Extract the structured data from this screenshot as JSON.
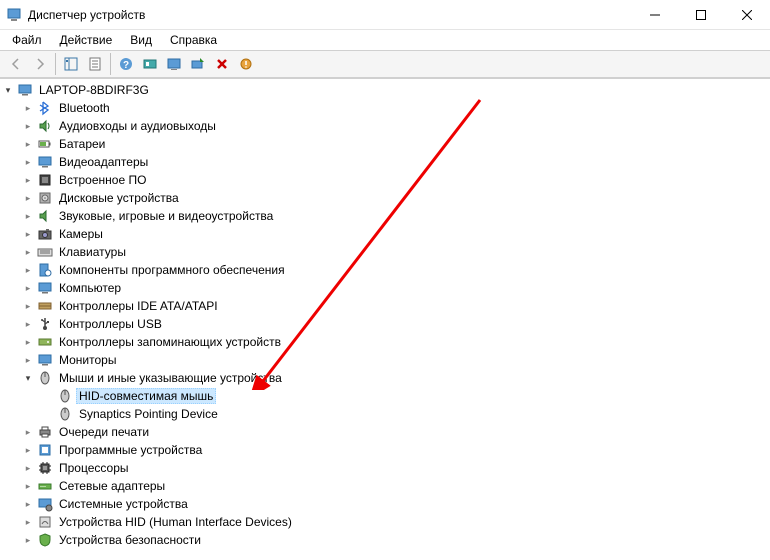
{
  "window": {
    "title": "Диспетчер устройств"
  },
  "menu": {
    "file": "Файл",
    "action": "Действие",
    "view": "Вид",
    "help": "Справка"
  },
  "tree": {
    "root": "LAPTOP-8BDIRF3G",
    "items": [
      {
        "label": "Bluetooth",
        "icon": "bluetooth"
      },
      {
        "label": "Аудиовходы и аудиовыходы",
        "icon": "audio"
      },
      {
        "label": "Батареи",
        "icon": "battery"
      },
      {
        "label": "Видеоадаптеры",
        "icon": "display"
      },
      {
        "label": "Встроенное ПО",
        "icon": "firmware"
      },
      {
        "label": "Дисковые устройства",
        "icon": "disk"
      },
      {
        "label": "Звуковые, игровые и видеоустройства",
        "icon": "sound"
      },
      {
        "label": "Камеры",
        "icon": "camera"
      },
      {
        "label": "Клавиатуры",
        "icon": "keyboard"
      },
      {
        "label": "Компоненты программного обеспечения",
        "icon": "software"
      },
      {
        "label": "Компьютер",
        "icon": "computer"
      },
      {
        "label": "Контроллеры IDE ATA/ATAPI",
        "icon": "ide"
      },
      {
        "label": "Контроллеры USB",
        "icon": "usb"
      },
      {
        "label": "Контроллеры запоминающих устройств",
        "icon": "storage"
      },
      {
        "label": "Мониторы",
        "icon": "monitor"
      },
      {
        "label": "Мыши и иные указывающие устройства",
        "icon": "mouse",
        "expanded": true,
        "children": [
          {
            "label": "HID-совместимая мышь",
            "icon": "mouse",
            "selected": true
          },
          {
            "label": "Synaptics Pointing Device",
            "icon": "mouse"
          }
        ]
      },
      {
        "label": "Очереди печати",
        "icon": "printer"
      },
      {
        "label": "Программные устройства",
        "icon": "softdev"
      },
      {
        "label": "Процессоры",
        "icon": "cpu"
      },
      {
        "label": "Сетевые адаптеры",
        "icon": "network"
      },
      {
        "label": "Системные устройства",
        "icon": "system"
      },
      {
        "label": "Устройства HID (Human Interface Devices)",
        "icon": "hid"
      },
      {
        "label": "Устройства безопасности",
        "icon": "security"
      }
    ]
  }
}
